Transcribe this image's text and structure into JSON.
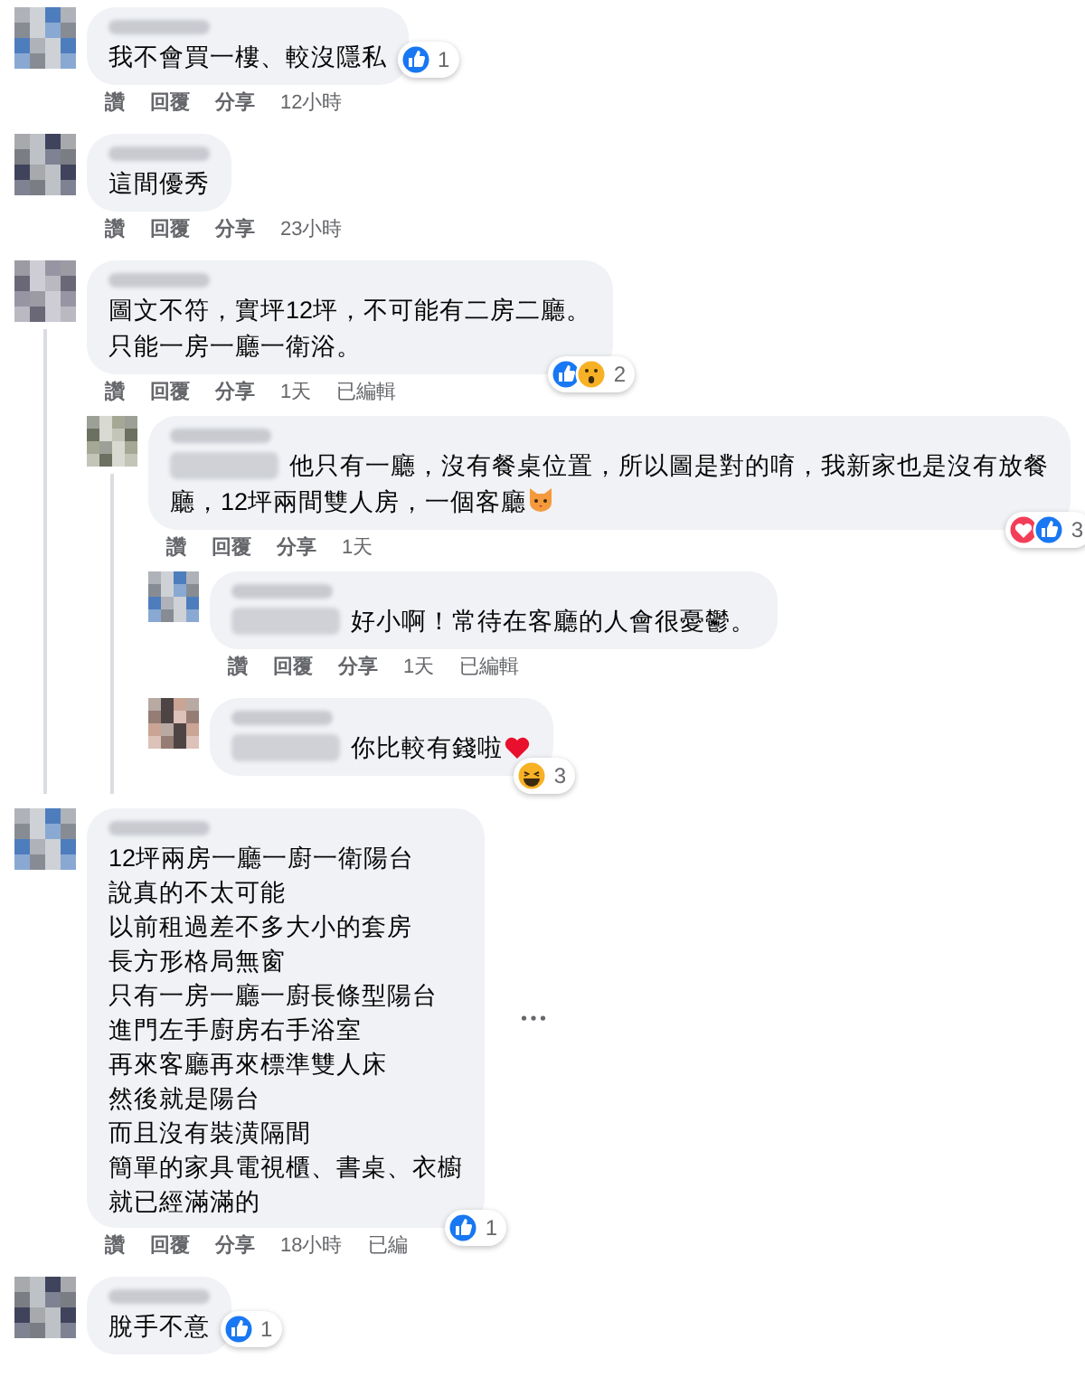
{
  "comments": [
    {
      "lines": [
        "我不會買一樓、較沒隱私"
      ],
      "actions": [
        "讚",
        "回覆",
        "分享",
        "12小時"
      ],
      "reactions": {
        "types": [
          {
            "kind": "like"
          }
        ],
        "count": "1"
      },
      "inline_reactions": true
    },
    {
      "lines": [
        "這間優秀"
      ],
      "actions": [
        "讚",
        "回覆",
        "分享",
        "23小時"
      ]
    },
    {
      "lines": [
        "圖文不符，實坪12坪，不可能有二房二廳。",
        "只能一房一廳一衛浴。"
      ],
      "actions": [
        "讚",
        "回覆",
        "分享",
        "1天",
        "已編輯"
      ],
      "reactions": {
        "types": [
          {
            "kind": "like"
          },
          {
            "kind": "wow"
          }
        ],
        "count": "2"
      },
      "replies": [
        {
          "lines": [
            "他只有一廳，沒有餐桌位置，所以圖是對的唷，我新家也是沒有放餐廳，12坪兩間雙人房，一個客廳"
          ],
          "mention": true,
          "actions": [
            "讚",
            "回覆",
            "分享",
            "1天"
          ],
          "reactions": {
            "types": [
              {
                "kind": "love"
              },
              {
                "kind": "like"
              }
            ],
            "count": "3"
          },
          "emoji": {
            "kind": "cat"
          },
          "replies": [
            {
              "lines": [
                "好小啊！常待在客廳的人會很憂鬱。"
              ],
              "mention": true,
              "actions": [
                "讚",
                "回覆",
                "分享",
                "1天",
                "已編輯"
              ]
            },
            {
              "lines": [
                "你比較有錢啦"
              ],
              "mention": true,
              "reactions": {
                "types": [
                  {
                    "kind": "haha"
                  }
                ],
                "count": "3"
              },
              "emoji": {
                "kind": "heart"
              }
            }
          ]
        }
      ]
    },
    {
      "lines": [
        "12坪兩房一廳一廚一衛陽台",
        "說真的不太可能",
        "以前租過差不多大小的套房",
        "長方形格局無窗",
        "只有一房一廳一廚長條型陽台",
        "進門左手廚房右手浴室",
        "再來客廳再來標準雙人床",
        "然後就是陽台",
        "而且沒有裝潢隔間",
        "簡單的家具電視櫃、書桌、衣櫥",
        "就已經滿滿的"
      ],
      "actions": [
        "讚",
        "回覆",
        "分享",
        "18小時",
        "已編"
      ],
      "reactions": {
        "types": [
          {
            "kind": "like"
          }
        ],
        "count": "1"
      },
      "more_button": true
    },
    {
      "lines": [
        "脫手不意"
      ],
      "reactions": {
        "types": [
          {
            "kind": "like"
          }
        ],
        "count": "1"
      },
      "inline_reactions": true
    }
  ]
}
